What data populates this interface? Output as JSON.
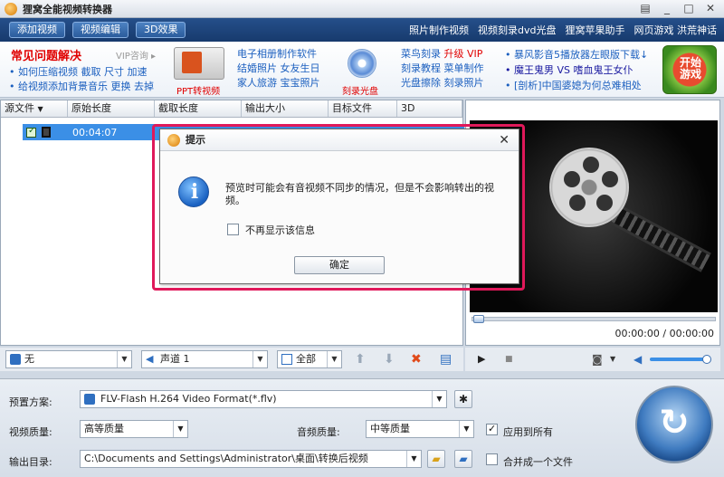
{
  "window": {
    "title": "狸窝全能视频转换器",
    "controls": [
      "▤",
      "_",
      "□",
      "✕"
    ]
  },
  "toolbar": {
    "tabs": [
      "添加视频",
      "视频编辑",
      "3D效果"
    ],
    "links": [
      "照片制作视频",
      "视频刻录dvd光盘",
      "狸窝苹果助手",
      "网页游戏 洪荒神话"
    ]
  },
  "ads": {
    "faq_title": "常见问题解决",
    "faq_vip": "VIP咨询 ▸",
    "faq_lines": [
      "• 如何压缩视频 截取 尺寸 加速",
      "• 给视频添加背景音乐 更换 去掉"
    ],
    "ppt_label": "PPT转视频",
    "col1": [
      "电子相册制作软件",
      "结婚照片 女友生日",
      "家人旅游 宝宝照片"
    ],
    "burn_label": "刻录光盘",
    "col2_line1": "菜鸟刻录",
    "col2_line1_hl": "升级 VIP",
    "col2_lines": [
      "刻录教程 菜单制作",
      "光盘擦除 刻录照片"
    ],
    "news": [
      "• 暴风影音5播放器左眼版下载↓",
      "• 魔王鬼男 VS 嗜血鬼王女仆",
      "• [剖析]中国婆媳为何总难相处"
    ],
    "game_label": "开始\n游戏"
  },
  "filelist": {
    "headers": [
      "源文件",
      "原始长度",
      "截取长度",
      "输出大小",
      "目标文件",
      "3D"
    ],
    "rows": [
      {
        "source_length": "00:04:07"
      }
    ]
  },
  "preview": {
    "time": "00:00:00 / 00:00:00",
    "progress": 0
  },
  "controls": {
    "subtitle": "无",
    "audio_track": "声道 1",
    "select_all": "全部"
  },
  "settings": {
    "preset_label": "预置方案:",
    "preset_value": "FLV-Flash H.264 Video Format(*.flv)",
    "video_quality_label": "视频质量:",
    "video_quality_value": "高等质量",
    "audio_quality_label": "音频质量:",
    "audio_quality_value": "中等质量",
    "apply_all_label": "应用到所有",
    "apply_all_checked": true,
    "output_dir_label": "输出目录:",
    "output_dir_value": "C:\\Documents and Settings\\Administrator\\桌面\\转换后视频",
    "merge_label": "合并成一个文件",
    "merge_checked": false
  },
  "dialog": {
    "title": "提示",
    "message": "预览时可能会有音视频不同步的情况，但是不会影响转出的视频。",
    "checkbox_label": "不再显示该信息",
    "ok_label": "确定"
  },
  "colors": {
    "accent": "#e0195a",
    "selection": "#3b8fe6",
    "toolbar": "#1d4478"
  }
}
